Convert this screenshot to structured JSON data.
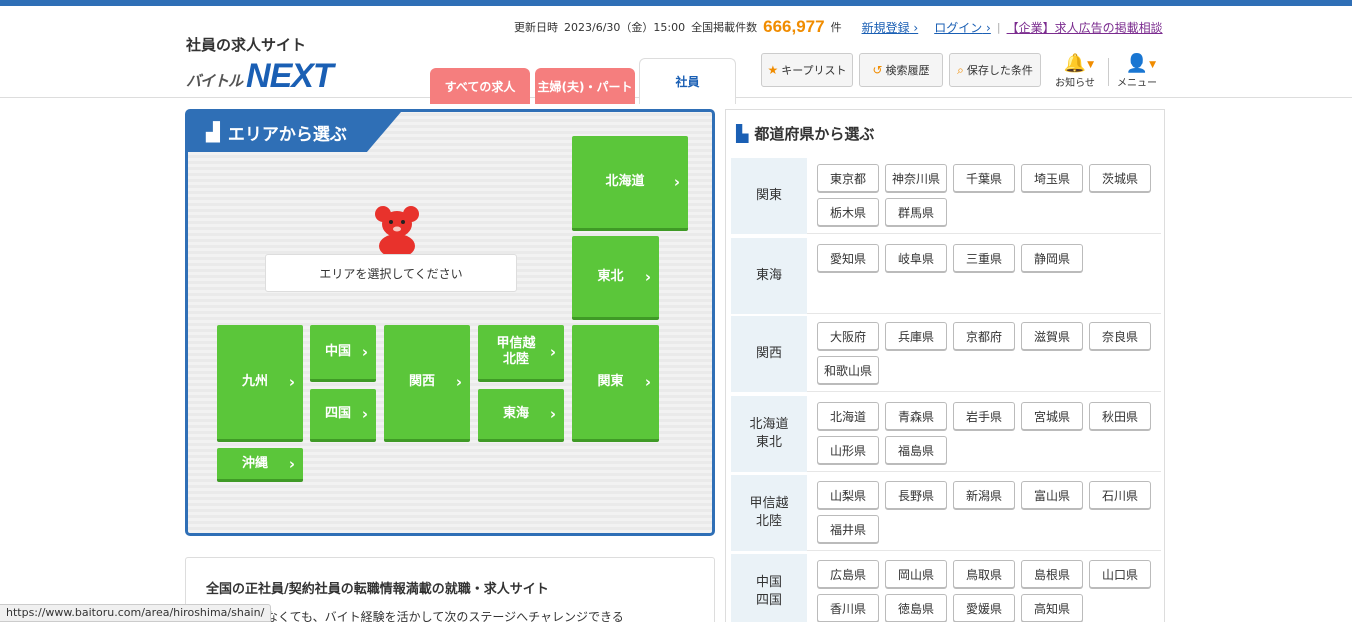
{
  "header": {
    "logo_sub": "社員の求人サイト",
    "logo_baitoru": "バイトル",
    "logo_next": "NEXT",
    "update_label": "更新日時",
    "update_date": "2023/6/30（金）15:00",
    "count_label": "全国掲載件数",
    "count_value": "666,977",
    "count_unit": "件",
    "register_link": "新規登録",
    "login_link": "ログイン",
    "corp_link": "【企業】求人広告の掲載相談",
    "tabs": [
      {
        "label": "すべての求人"
      },
      {
        "label": "主婦(夫)・パート"
      },
      {
        "label": "社員"
      }
    ],
    "tools": {
      "keep_list": "キープリスト",
      "history": "検索履歴",
      "saved": "保存した条件",
      "notice": "お知らせ",
      "menu": "メニュー"
    }
  },
  "area": {
    "title": "エリアから選ぶ",
    "select_msg": "エリアを選択してください",
    "regions": {
      "hokkaido": "北海道",
      "tohoku": "東北",
      "kyushu": "九州",
      "chugoku": "中国",
      "shikoku": "四国",
      "kansai": "関西",
      "koshinetsu": "甲信越\n北陸",
      "tokai": "東海",
      "kanto": "関東",
      "okinawa": "沖縄"
    }
  },
  "prefectures": {
    "title": "都道府県から選ぶ",
    "rows": [
      {
        "region": "関東",
        "prefs": [
          "東京都",
          "神奈川県",
          "千葉県",
          "埼玉県",
          "茨城県",
          "栃木県",
          "群馬県"
        ]
      },
      {
        "region": "東海",
        "prefs": [
          "愛知県",
          "岐阜県",
          "三重県",
          "静岡県"
        ]
      },
      {
        "region": "関西",
        "prefs": [
          "大阪府",
          "兵庫県",
          "京都府",
          "滋賀県",
          "奈良県",
          "和歌山県"
        ]
      },
      {
        "region": "北海道\n東北",
        "prefs": [
          "北海道",
          "青森県",
          "岩手県",
          "宮城県",
          "秋田県",
          "山形県",
          "福島県"
        ]
      },
      {
        "region": "甲信越\n北陸",
        "prefs": [
          "山梨県",
          "長野県",
          "新潟県",
          "富山県",
          "石川県",
          "福井県"
        ]
      },
      {
        "region": "中国\n四国",
        "prefs": [
          "広島県",
          "岡山県",
          "鳥取県",
          "島根県",
          "山口県",
          "香川県",
          "徳島県",
          "愛媛県",
          "高知県"
        ]
      }
    ]
  },
  "intro": {
    "title": "全国の正社員/契約社員の転職情報満載の就職・求人サイト",
    "body": "キャリアがなくても、バイト経験を活かして次のステージへチャレンジできる"
  },
  "status_url": "https://www.baitoru.com/area/hiroshima/shain/",
  "colors": {
    "brand_blue": "#2f6fb6",
    "area_green": "#5bc63a",
    "tab_pink": "#f57e7e",
    "count_orange": "#f08c00"
  }
}
